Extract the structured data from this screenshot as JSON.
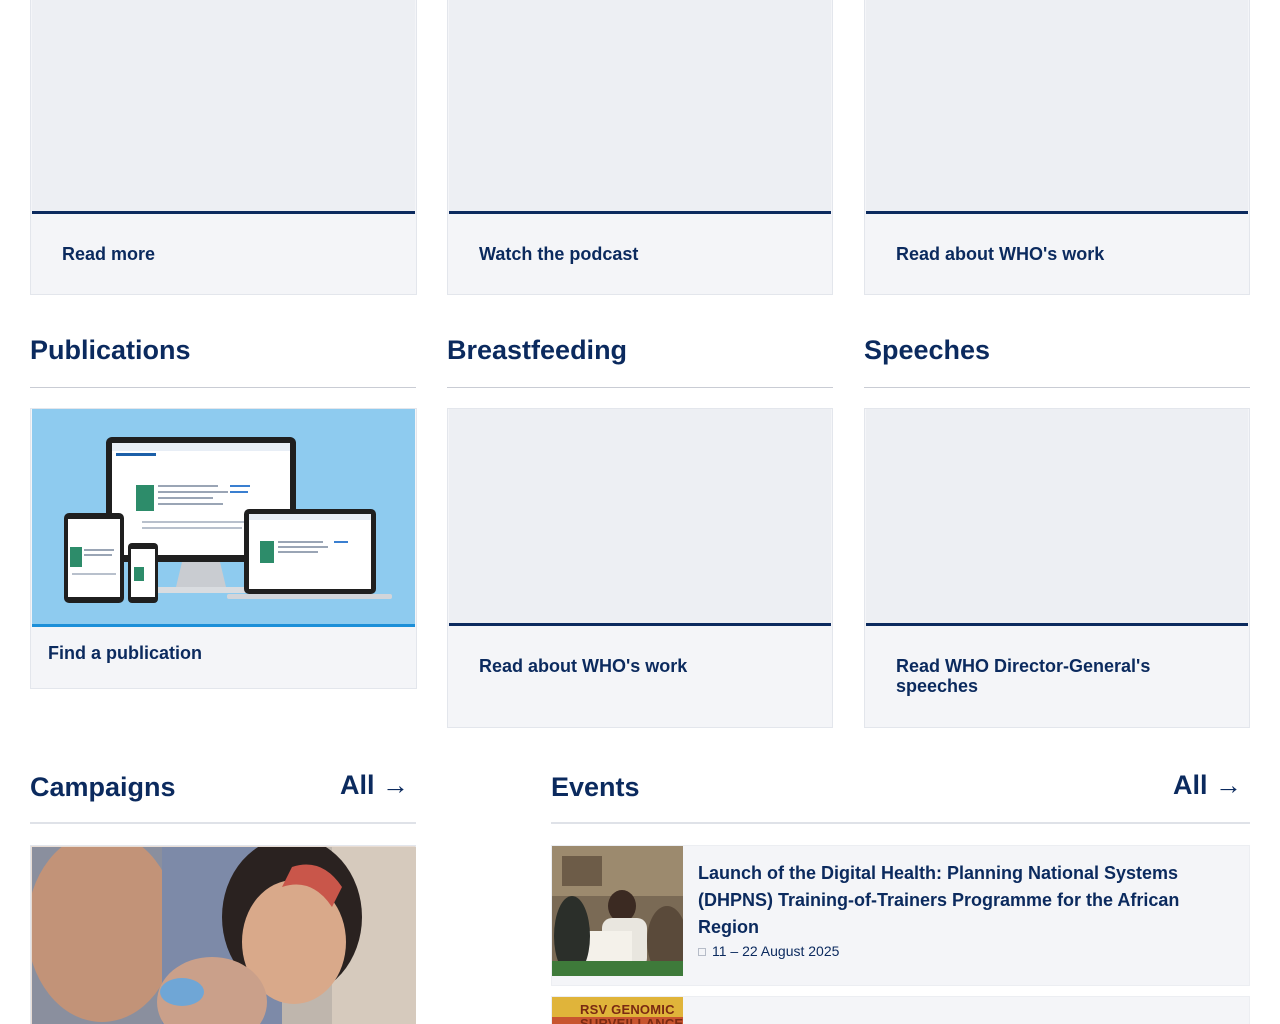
{
  "top_cards": [
    {
      "cta": "Read more"
    },
    {
      "cta": "Watch the podcast"
    },
    {
      "cta": "Read about WHO's work"
    }
  ],
  "sections": {
    "publications": {
      "title": "Publications",
      "cta": "Find a publication"
    },
    "breastfeeding": {
      "title": "Breastfeeding",
      "cta": "Read about WHO's work"
    },
    "speeches": {
      "title": "Speeches",
      "cta": "Read WHO Director-General's speeches"
    }
  },
  "campaigns": {
    "title": "Campaigns",
    "all_label": "All →"
  },
  "events": {
    "title": "Events",
    "all_label": "All →",
    "items": [
      {
        "title": "Launch of the Digital Health: Planning National Systems (DHPNS) Training-of-Trainers Programme for the African Region",
        "date": "11 – 22 August 2025",
        "date_icon": "calendar-icon"
      },
      {
        "title": "",
        "thumb_text": "RSV GENOMIC SURVEILLANCE"
      }
    ]
  },
  "colors": {
    "brand_navy": "#0b2a5e",
    "card_bg": "#f4f5f8",
    "accent_blue": "#1c8fd8"
  }
}
